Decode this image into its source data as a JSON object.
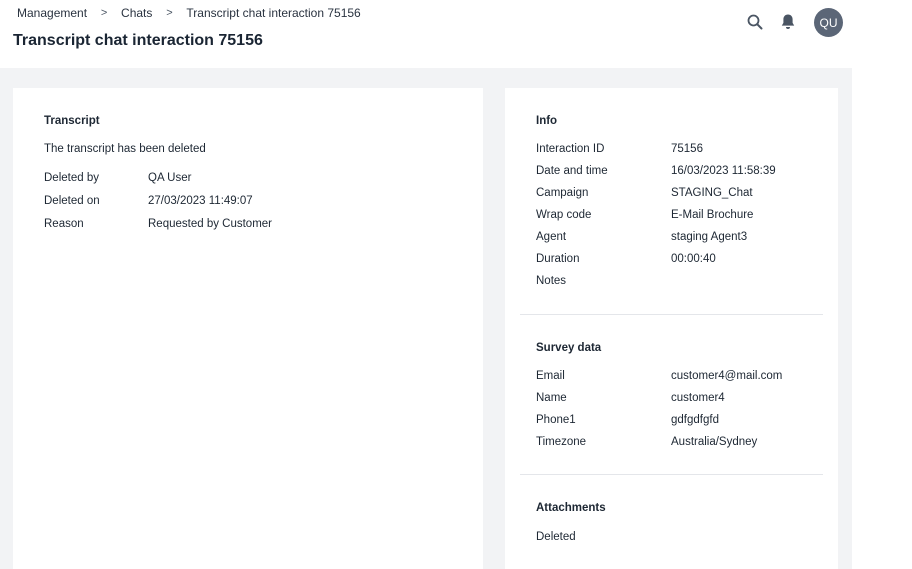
{
  "breadcrumb": {
    "items": [
      "Management",
      "Chats",
      "Transcript chat interaction 75156"
    ],
    "separator": ">"
  },
  "page_title": "Transcript chat interaction 75156",
  "header": {
    "avatar_initials": "QU",
    "icons": [
      "search-icon",
      "bell-icon"
    ]
  },
  "transcript": {
    "title": "Transcript",
    "status": "The transcript has been deleted",
    "fields": [
      {
        "label": "Deleted by",
        "value": "QA User"
      },
      {
        "label": "Deleted on",
        "value": "27/03/2023 11:49:07"
      },
      {
        "label": "Reason",
        "value": "Requested by Customer"
      }
    ]
  },
  "info": {
    "title": "Info",
    "fields": [
      {
        "label": "Interaction ID",
        "value": "75156"
      },
      {
        "label": "Date and time",
        "value": "16/03/2023 11:58:39"
      },
      {
        "label": "Campaign",
        "value": "STAGING_Chat"
      },
      {
        "label": "Wrap code",
        "value": "E-Mail Brochure"
      },
      {
        "label": "Agent",
        "value": "staging Agent3"
      },
      {
        "label": "Duration",
        "value": "00:00:40"
      },
      {
        "label": "Notes",
        "value": ""
      }
    ]
  },
  "survey": {
    "title": "Survey data",
    "fields": [
      {
        "label": "Email",
        "value": "customer4@mail.com"
      },
      {
        "label": "Name",
        "value": "customer4"
      },
      {
        "label": "Phone1",
        "value": "gdfgdfgfd"
      },
      {
        "label": "Timezone",
        "value": "Australia/Sydney"
      }
    ]
  },
  "attachments": {
    "title": "Attachments",
    "status": "Deleted"
  },
  "colors": {
    "page_bg": "#f2f3f5",
    "card_bg": "#ffffff",
    "text": "#1d2733",
    "avatar_bg": "#5b6677",
    "icon": "#4a5563"
  }
}
